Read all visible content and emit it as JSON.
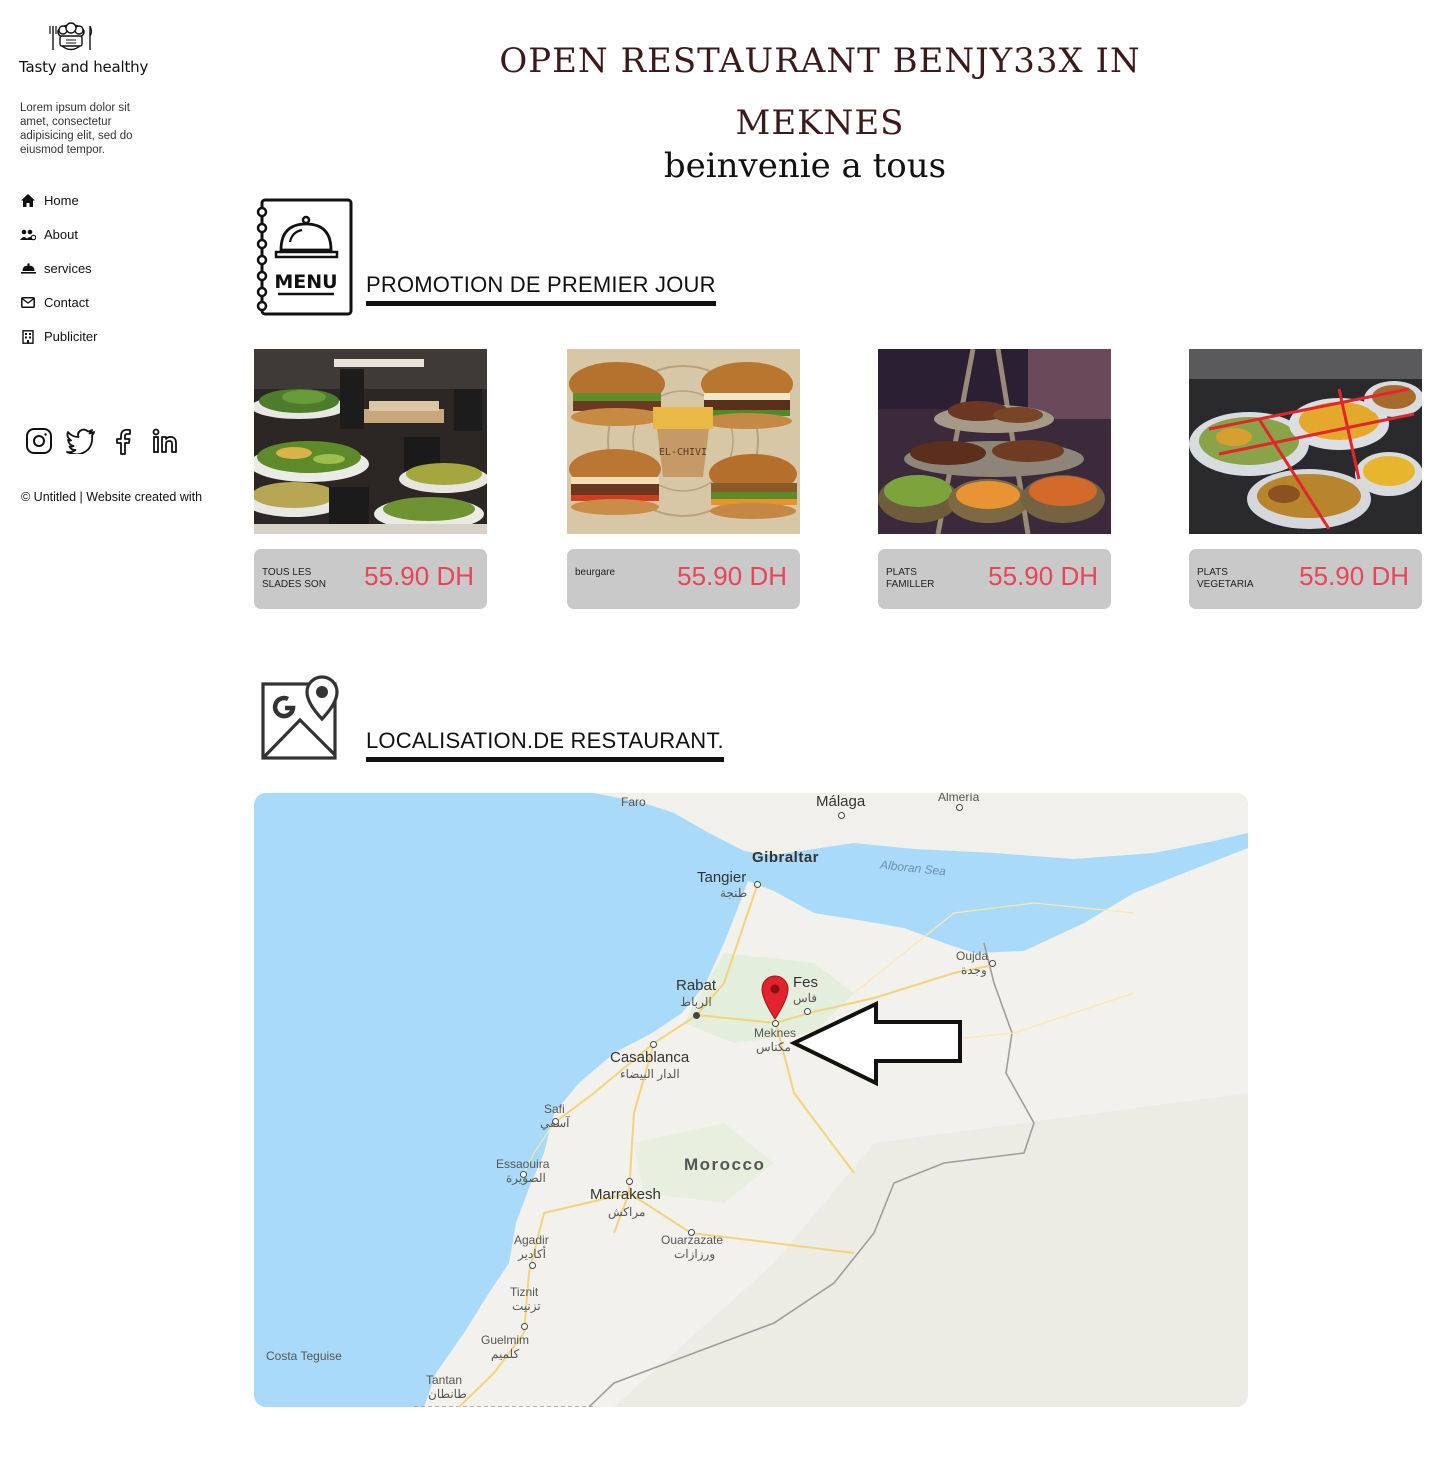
{
  "sidebar": {
    "brand": "Tasty and healthy",
    "tagline": "Lorem ipsum dolor sit amet, consectetur adipisicing elit, sed do eiusmod tempor.",
    "nav": [
      {
        "label": "Home",
        "icon": "home-icon"
      },
      {
        "label": "About",
        "icon": "users-icon"
      },
      {
        "label": "services",
        "icon": "cloche-icon"
      },
      {
        "label": "Contact",
        "icon": "mail-icon"
      },
      {
        "label": "Publiciter",
        "icon": "building-icon"
      }
    ],
    "socials": [
      "instagram-icon",
      "twitter-icon",
      "facebook-icon",
      "linkedin-icon"
    ],
    "copyright": "© Untitled | Website created with"
  },
  "header": {
    "title_line1": "OPEN RESTAURANT BENJY33X IN",
    "title_line2": "MEKNES",
    "subtitle": "beinvenie a tous"
  },
  "promo": {
    "menu_icon_text": "MENU",
    "heading": "PROMOTION DE PREMIER JOUR",
    "items": [
      {
        "name": "TOUS LES SLADES SON",
        "price": "55.90 DH"
      },
      {
        "name": "beurgare",
        "price": "55.90 DH"
      },
      {
        "name": "PLATS FAMILLER",
        "price": "55.90 DH"
      },
      {
        "name": "PLATS VEGETARIA",
        "price": "55.90 DH"
      }
    ],
    "photo_texts": {
      "burger_sign": "EL-CHIVI"
    }
  },
  "location": {
    "heading": "LOCALISATION.DE RESTAURANT.",
    "map_labels": {
      "faro": "Faro",
      "malaga": "Málaga",
      "almeria": "Almería",
      "gibraltar": "Gibraltar",
      "alboran": "Alboran Sea",
      "tangier": "Tangier",
      "tangier_ar": "طنجة",
      "oujda": "Oujda",
      "oujda_ar": "وجدة",
      "rabat": "Rabat",
      "rabat_ar": "الرباط",
      "fes": "Fes",
      "fes_ar": "فاس",
      "meknes": "Meknes",
      "meknes_ar": "مكناس",
      "casablanca": "Casablanca",
      "casablanca_ar": "الدار البيضاء",
      "safi": "Safi",
      "safi_ar": "آسفي",
      "essaouira": "Essaouira",
      "essaouira_ar": "الصويرة",
      "morocco": "Morocco",
      "marrakesh": "Marrakesh",
      "marrakesh_ar": "مراكش",
      "agadir": "Agadir",
      "agadir_ar": "أكادير",
      "ouarzazate": "Ouarzazate",
      "ouarzazate_ar": "ورزازات",
      "tiznit": "Tiznit",
      "tiznit_ar": "تزنيت",
      "guelmim": "Guelmim",
      "guelmim_ar": "كلميم",
      "costa": "Costa Teguise",
      "tantan": "Tantan",
      "tantan_ar": "طانطان"
    }
  },
  "colors": {
    "title": "#3b1a1c",
    "price": "#e8445a",
    "price_box": "#c9c9c9",
    "sea": "#a9dafa",
    "land": "#f2f1ec",
    "pin": "#e0232f"
  }
}
